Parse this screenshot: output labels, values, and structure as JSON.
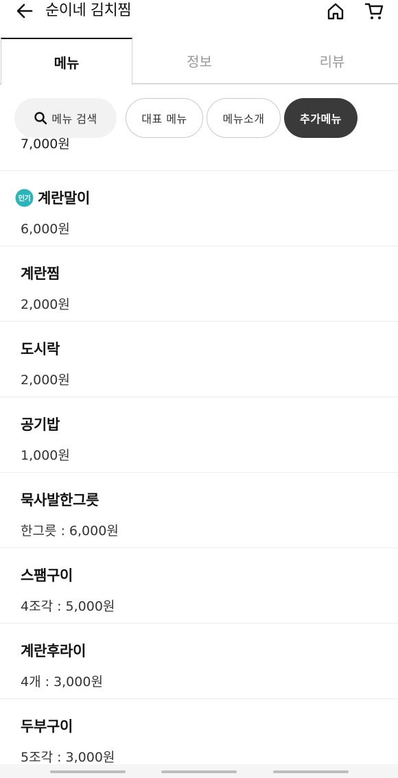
{
  "header": {
    "title": "순이네 김치찜",
    "back_icon": "arrow-left-icon",
    "home_icon": "home-icon",
    "cart_icon": "cart-icon"
  },
  "tabs": [
    {
      "label": "메뉴",
      "active": true
    },
    {
      "label": "정보",
      "active": false
    },
    {
      "label": "리뷰",
      "active": false
    }
  ],
  "chips": {
    "search_label": "메뉴 검색",
    "representative": "대표 메뉴",
    "intro": "메뉴소개",
    "extra": "추가메뉴"
  },
  "menu_items": [
    {
      "name": "계란말이",
      "price": "6,000원",
      "badge": "인기"
    },
    {
      "name": "계란찜",
      "price": "2,000원"
    },
    {
      "name": "도시락",
      "price": "2,000원"
    },
    {
      "name": "공기밥",
      "price": "1,000원"
    },
    {
      "name": "묵사발한그릇",
      "price": "한그릇 : 6,000원"
    },
    {
      "name": "스팸구이",
      "price": "4조각 : 5,000원"
    },
    {
      "name": "계란후라이",
      "price": "4개 : 3,000원"
    },
    {
      "name": "두부구이",
      "price": "5조각 : 3,000원"
    }
  ],
  "colors": {
    "accent_dark": "#3a3a3a",
    "badge_teal": "#2bb5b8",
    "divider": "#ececec"
  }
}
